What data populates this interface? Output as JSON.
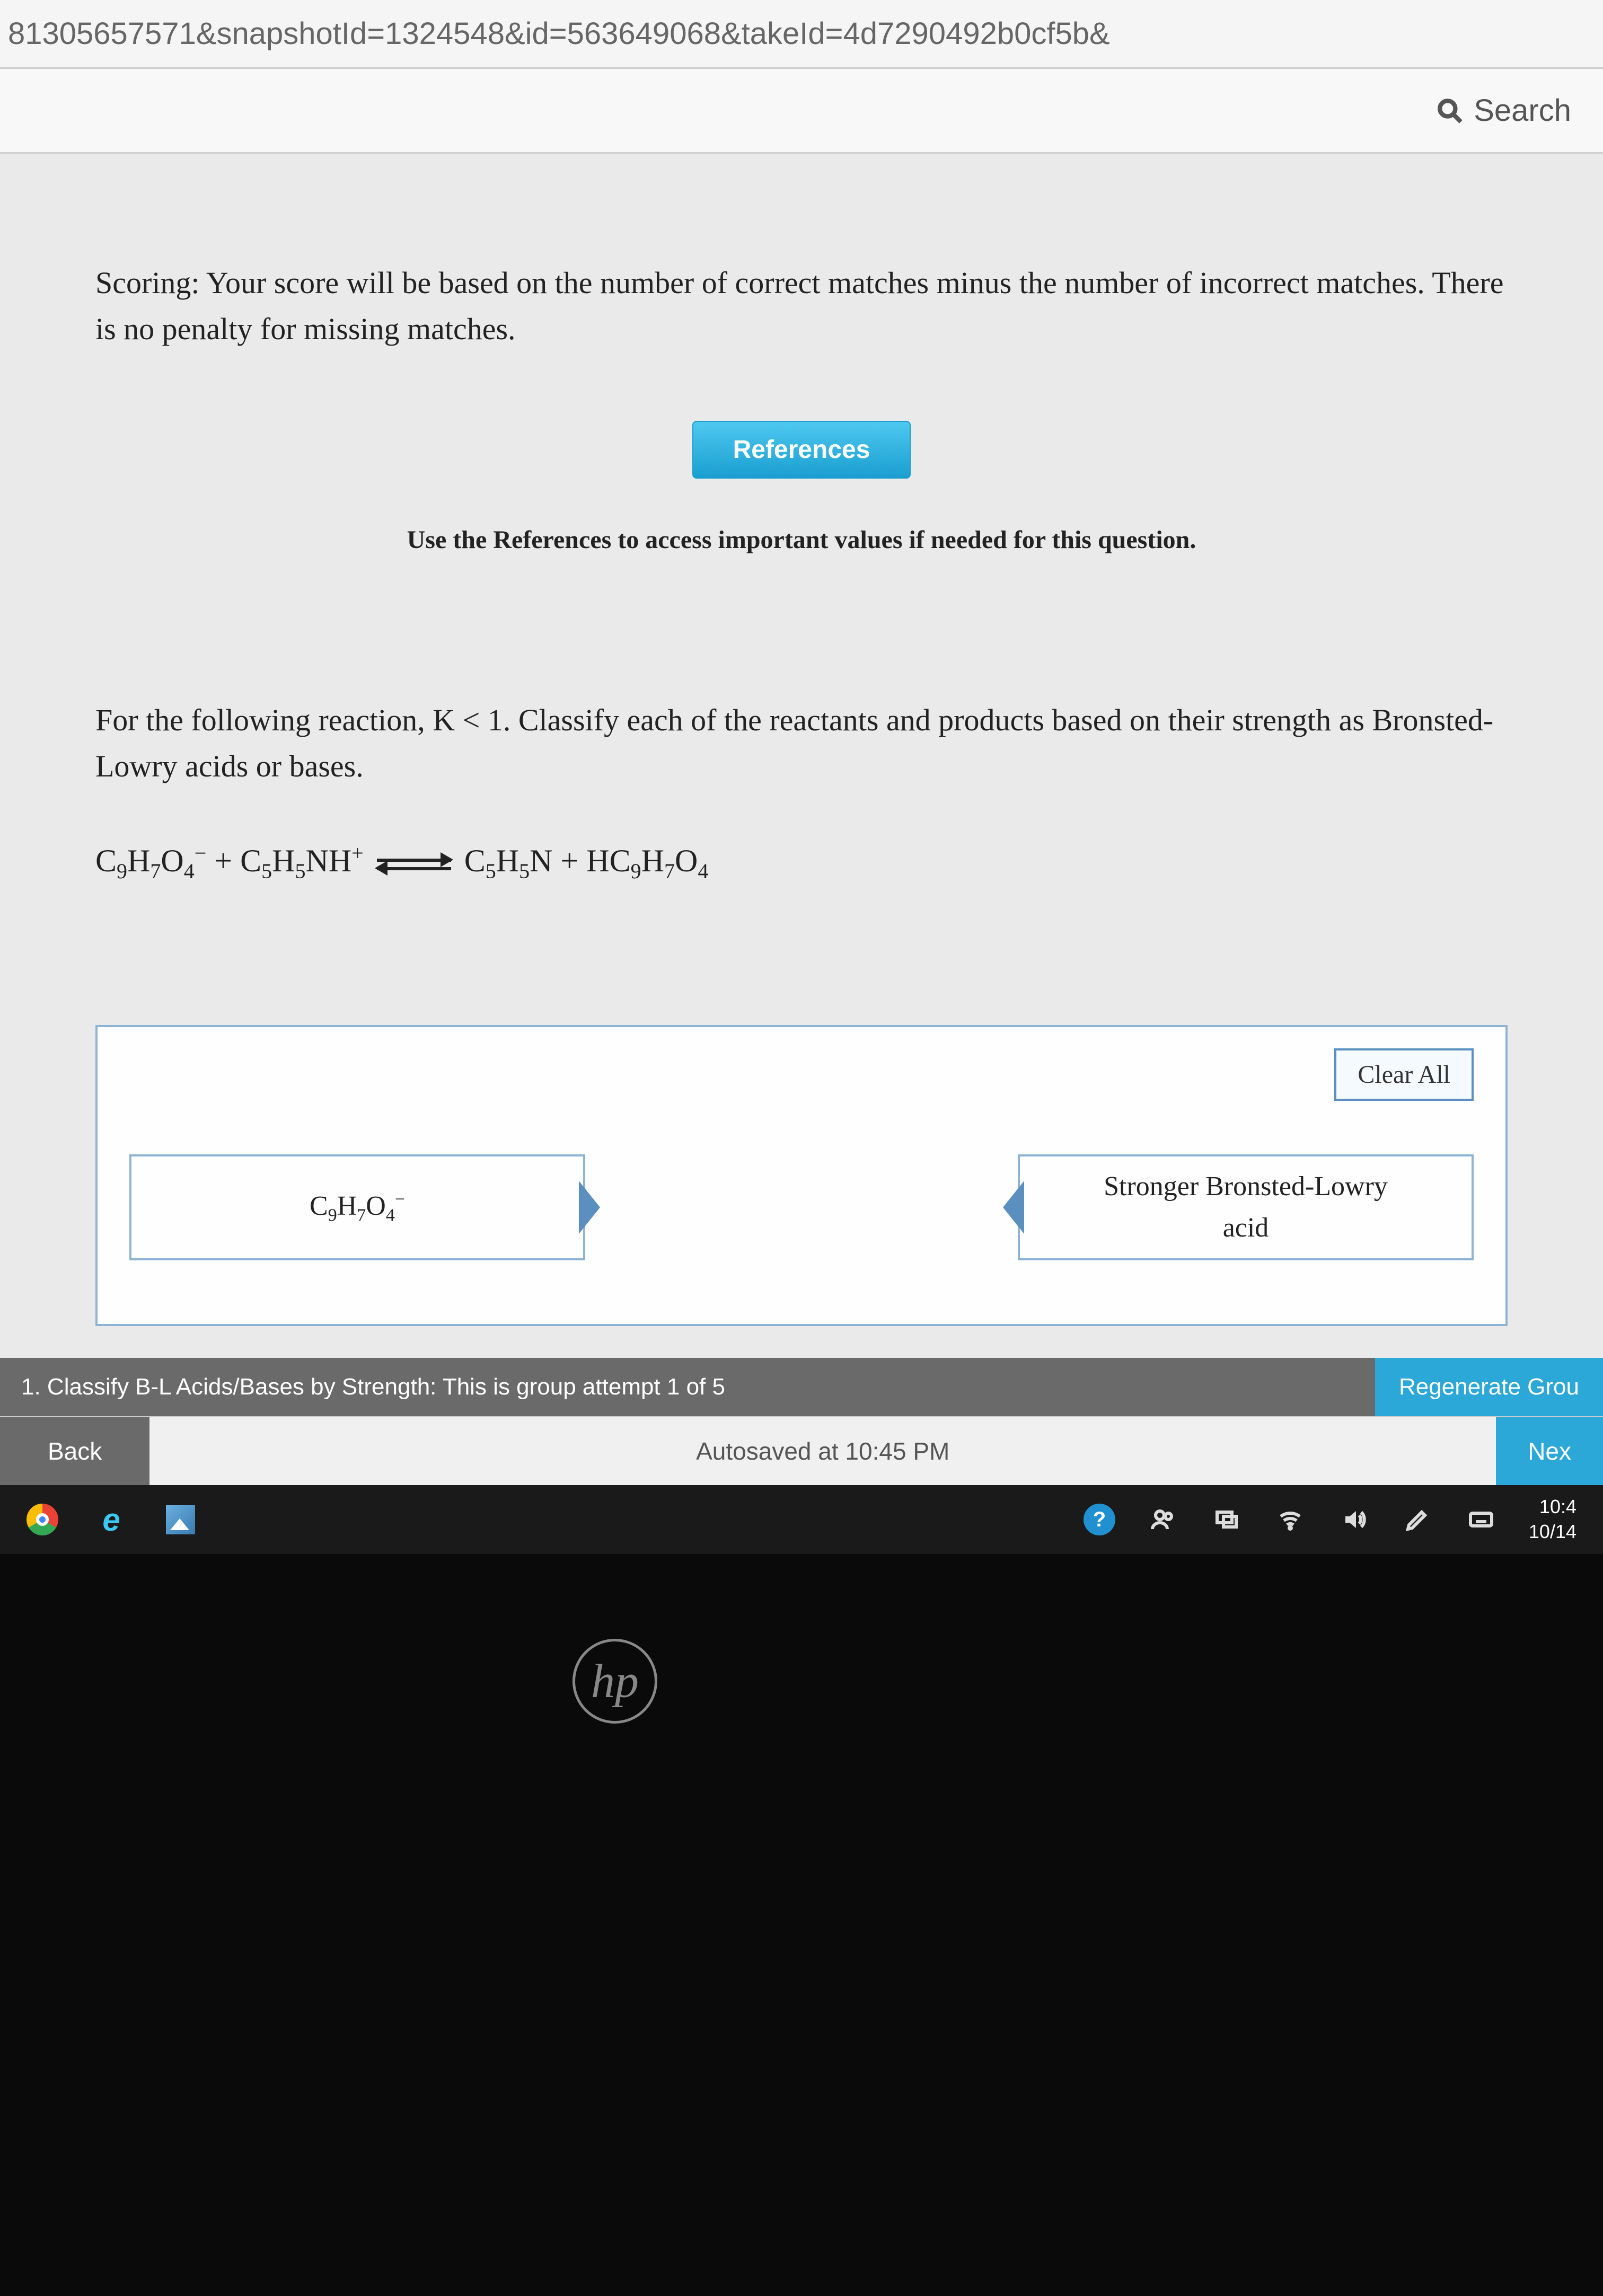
{
  "url_fragment": "81305657571&snapshotId=1324548&id=563649068&takeId=4d7290492b0cf5b&",
  "toolbar": {
    "search_label": "Search"
  },
  "scoring": "Scoring: Your score will be based on the number of correct matches minus the number of incorrect matches. There is no penalty for missing matches.",
  "references_label": "References",
  "references_hint": "Use the References to access important values if needed for this question.",
  "question_intro": "For the following reaction, K < 1. Classify each of the reactants and products based on their strength as Bronsted-Lowry acids or bases.",
  "clear_all_label": "Clear All",
  "tiles": {
    "left_formula_html": "C<sub>9</sub>H<sub>7</sub>O<sub>4</sub><sup>−</sup>",
    "right_label_line1": "Stronger Bronsted-Lowry",
    "right_label_line2": "acid"
  },
  "status_bar": {
    "text": "1. Classify B-L Acids/Bases by Strength: This is group attempt 1 of 5",
    "regenerate_label": "Regenerate Grou"
  },
  "nav": {
    "back_label": "Back",
    "autosave_label": "Autosaved at 10:45 PM",
    "next_label": "Nex"
  },
  "taskbar": {
    "time": "10:4",
    "date": "10/14"
  }
}
